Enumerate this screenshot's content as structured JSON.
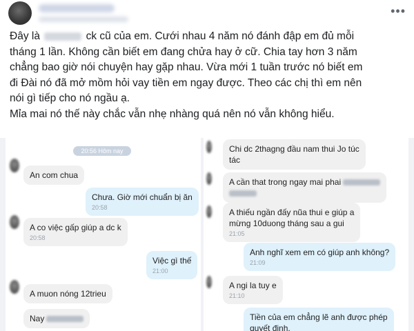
{
  "post": {
    "lines": [
      {
        "before": "Đây là",
        "after": "ck cũ của em. Cưới nhau 4 năm nó đánh đập em đủ mỗi"
      },
      {
        "text": "tháng 1 lần. Không cần biết em đang chửa hay ở cữ. Chia tay hơn 3 năm"
      },
      {
        "text": "chẳng bao giờ nói chuyện hay gặp nhau. Vừa mới 1 tuần trước nó biết em"
      },
      {
        "text": "đi Đài nó đã mở mồm hỏi vay tiền em ngay được. Theo các chị thì em nên"
      },
      {
        "text": "nói gì tiếp cho nó ngầu ạ."
      },
      {
        "text": "Mỉa mai nó thế này chắc vẫn nhẹ nhàng quá nên nó vẫn không hiểu."
      }
    ],
    "more_icon": "more-horizontal-icon"
  },
  "chat_left": {
    "date_label": "20:56 Hôm nay",
    "messages": [
      {
        "text": "An com chua",
        "time": ""
      },
      {
        "text": "Chưa. Giờ mới chuẩn bị ăn",
        "time": "20:58"
      },
      {
        "text": "A co việc gấp giúp a dc k",
        "time": "20:58"
      },
      {
        "text": "Việc gì thế",
        "time": "21:00"
      },
      {
        "text": "A muon nóng 12trieu",
        "time": ""
      },
      {
        "text": "Nay",
        "time": ""
      }
    ]
  },
  "chat_right": {
    "messages": [
      {
        "text": "Chi dc 2thagng đầu nam thui Jo túc",
        "text2": "tác",
        "time": ""
      },
      {
        "text": "A cần that trong ngay mai phai",
        "time": ""
      },
      {
        "text": "A thiếu ngần đấy nũa thui e giúp a",
        "text2": "mừng 10duong tháng sau a gui",
        "time": "21:05"
      },
      {
        "text": "Anh nghĩ xem em có giúp anh không?",
        "time": "21:09"
      },
      {
        "text": "A ngi la tuy e",
        "time": "21:10"
      },
      {
        "text": "Tiền của em chẳng lẽ anh được phép",
        "text2": "quyết định.",
        "time": ""
      }
    ]
  },
  "colors": {
    "incoming_bubble": "#f0f0f0",
    "outgoing_bubble": "#dff1fb",
    "chat_background": "#f1f2f6",
    "text": "#1c1e21"
  }
}
